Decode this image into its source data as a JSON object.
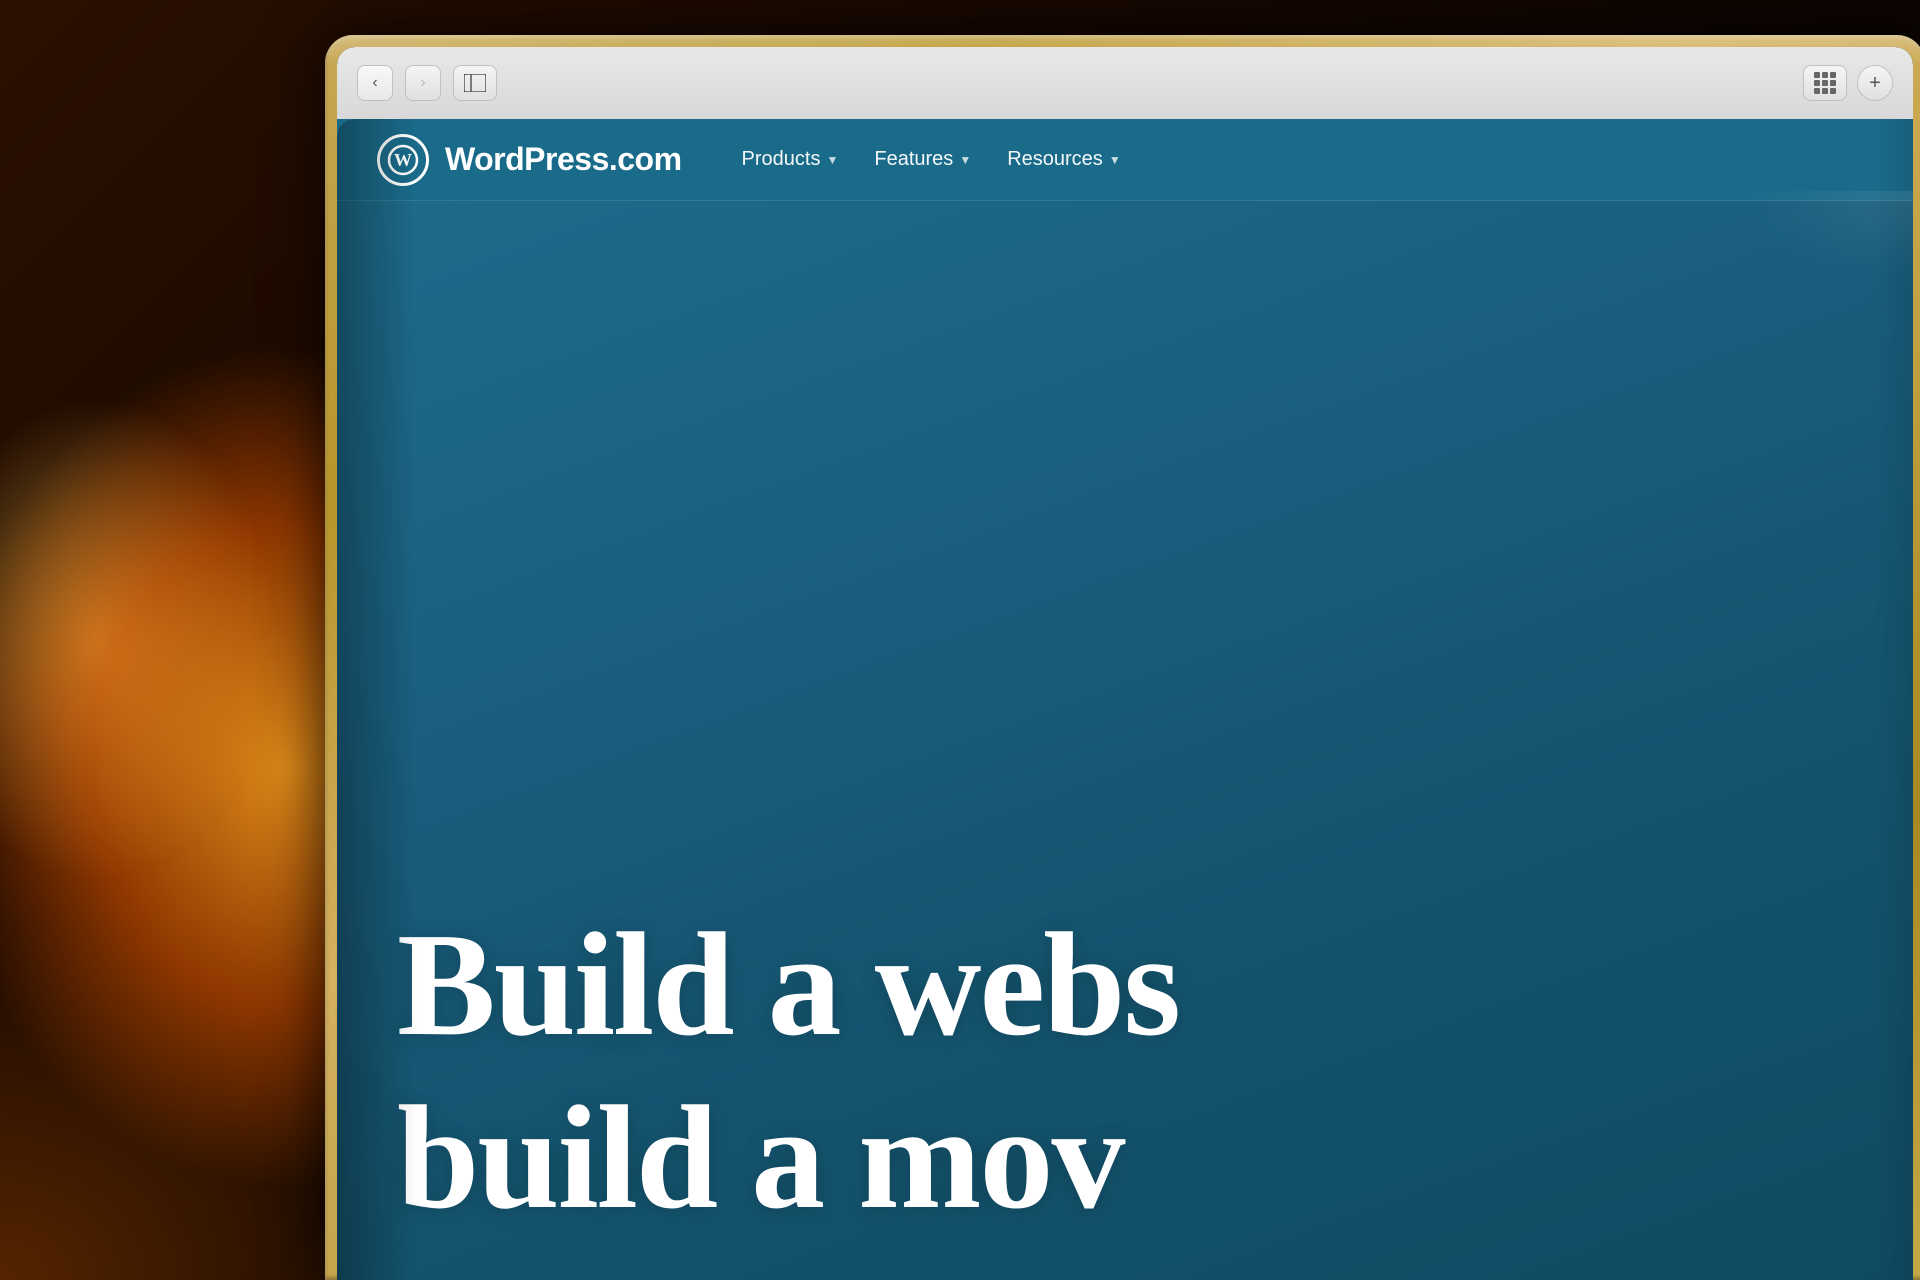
{
  "background": {
    "description": "Warm bokeh background photo with orange/amber light"
  },
  "laptop": {
    "frame_color": "#c4a848"
  },
  "browser": {
    "back_button": "‹",
    "forward_button": "›",
    "sidebar_button": "⊟",
    "plus_button": "+",
    "back_disabled": false,
    "forward_disabled": true
  },
  "website": {
    "logo_letter": "W",
    "site_name": "WordPress.com",
    "nav_items": [
      {
        "label": "Products",
        "has_arrow": true
      },
      {
        "label": "Features",
        "has_arrow": true
      },
      {
        "label": "Resources",
        "has_arrow": true
      }
    ],
    "hero_line1": "Build a webs",
    "hero_line2": "build a mov",
    "background_color": "#1d7a9a"
  }
}
